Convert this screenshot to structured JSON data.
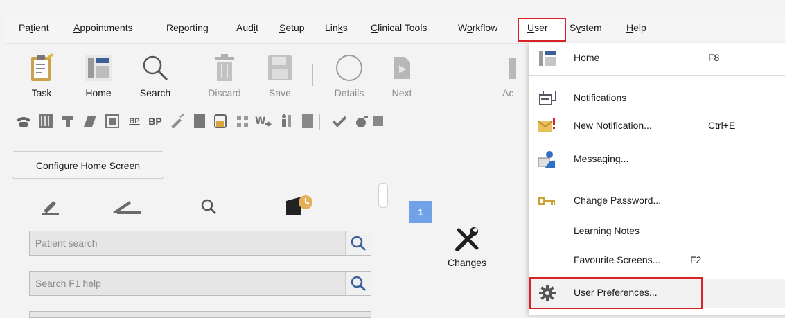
{
  "menubar": {
    "items": [
      "Patient",
      "Appointments",
      "Reporting",
      "Audit",
      "Setup",
      "Links",
      "Clinical Tools",
      "Workflow",
      "User",
      "System",
      "Help"
    ],
    "mnemonics": [
      "t",
      "A",
      "p",
      "i",
      "S",
      "k",
      "C",
      "o",
      "U",
      "y",
      "H"
    ],
    "active": "User"
  },
  "toolbar": {
    "task": "Task",
    "home": "Home",
    "search": "Search",
    "discard": "Discard",
    "save": "Save",
    "details": "Details",
    "next": "Next",
    "partial": "Ac"
  },
  "iconrow": {
    "bp1": "BP",
    "bp2": "BP"
  },
  "configure_home_label": "Configure Home Screen",
  "patient_search_placeholder": "Patient search",
  "help_search_placeholder": "Search F1 help",
  "badge_count": "1",
  "changes_label": "Changes",
  "dropdown": {
    "home": {
      "label": "Home",
      "shortcut": "F8"
    },
    "notifications": {
      "label": "Notifications"
    },
    "new_notification": {
      "label": "New Notification...",
      "shortcut": "Ctrl+E"
    },
    "messaging": {
      "label": "Messaging..."
    },
    "change_password": {
      "label": "Change Password..."
    },
    "learning_notes": {
      "label": "Learning Notes"
    },
    "favourite_screens": {
      "label": "Favourite Screens...",
      "shortcut": "F2"
    },
    "user_preferences": {
      "label": "User Preferences..."
    }
  },
  "colors": {
    "highlight": "#d8232a",
    "badge": "#6fa3e6"
  }
}
